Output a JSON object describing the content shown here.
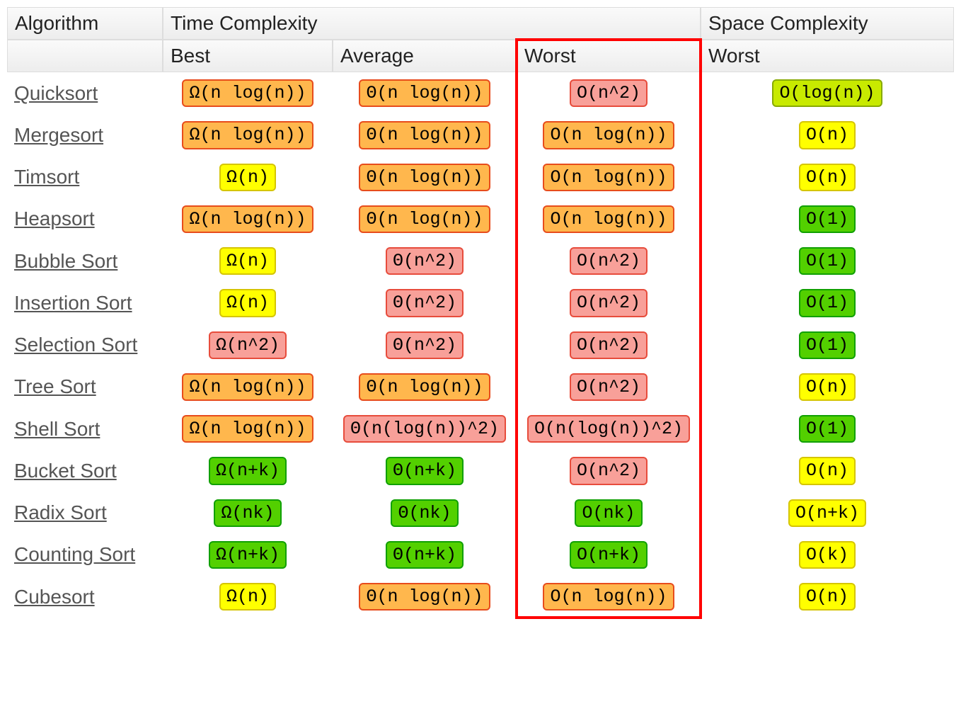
{
  "header": {
    "algorithm": "Algorithm",
    "time": "Time Complexity",
    "space": "Space Complexity",
    "best": "Best",
    "average": "Average",
    "worst": "Worst"
  },
  "colors": {
    "green": "c-green",
    "yellowgreen": "c-yg",
    "yellow": "c-yellow",
    "orange": "c-orange",
    "red": "c-red"
  },
  "rows": [
    {
      "name": "Quicksort",
      "best": {
        "v": "Ω(n log(n))",
        "c": "orange"
      },
      "avg": {
        "v": "Θ(n log(n))",
        "c": "orange"
      },
      "worst": {
        "v": "O(n^2)",
        "c": "red"
      },
      "space": {
        "v": "O(log(n))",
        "c": "yellowgreen"
      }
    },
    {
      "name": "Mergesort",
      "best": {
        "v": "Ω(n log(n))",
        "c": "orange"
      },
      "avg": {
        "v": "Θ(n log(n))",
        "c": "orange"
      },
      "worst": {
        "v": "O(n log(n))",
        "c": "orange"
      },
      "space": {
        "v": "O(n)",
        "c": "yellow"
      }
    },
    {
      "name": "Timsort",
      "best": {
        "v": "Ω(n)",
        "c": "yellow"
      },
      "avg": {
        "v": "Θ(n log(n))",
        "c": "orange"
      },
      "worst": {
        "v": "O(n log(n))",
        "c": "orange"
      },
      "space": {
        "v": "O(n)",
        "c": "yellow"
      }
    },
    {
      "name": "Heapsort",
      "best": {
        "v": "Ω(n log(n))",
        "c": "orange"
      },
      "avg": {
        "v": "Θ(n log(n))",
        "c": "orange"
      },
      "worst": {
        "v": "O(n log(n))",
        "c": "orange"
      },
      "space": {
        "v": "O(1)",
        "c": "green"
      }
    },
    {
      "name": "Bubble Sort",
      "best": {
        "v": "Ω(n)",
        "c": "yellow"
      },
      "avg": {
        "v": "Θ(n^2)",
        "c": "red"
      },
      "worst": {
        "v": "O(n^2)",
        "c": "red"
      },
      "space": {
        "v": "O(1)",
        "c": "green"
      }
    },
    {
      "name": "Insertion Sort",
      "best": {
        "v": "Ω(n)",
        "c": "yellow"
      },
      "avg": {
        "v": "Θ(n^2)",
        "c": "red"
      },
      "worst": {
        "v": "O(n^2)",
        "c": "red"
      },
      "space": {
        "v": "O(1)",
        "c": "green"
      }
    },
    {
      "name": "Selection Sort",
      "best": {
        "v": "Ω(n^2)",
        "c": "red"
      },
      "avg": {
        "v": "Θ(n^2)",
        "c": "red"
      },
      "worst": {
        "v": "O(n^2)",
        "c": "red"
      },
      "space": {
        "v": "O(1)",
        "c": "green"
      }
    },
    {
      "name": "Tree Sort",
      "best": {
        "v": "Ω(n log(n))",
        "c": "orange"
      },
      "avg": {
        "v": "Θ(n log(n))",
        "c": "orange"
      },
      "worst": {
        "v": "O(n^2)",
        "c": "red"
      },
      "space": {
        "v": "O(n)",
        "c": "yellow"
      }
    },
    {
      "name": "Shell Sort",
      "best": {
        "v": "Ω(n log(n))",
        "c": "orange"
      },
      "avg": {
        "v": "Θ(n(log(n))^2)",
        "c": "red"
      },
      "worst": {
        "v": "O(n(log(n))^2)",
        "c": "red"
      },
      "space": {
        "v": "O(1)",
        "c": "green"
      }
    },
    {
      "name": "Bucket Sort",
      "best": {
        "v": "Ω(n+k)",
        "c": "green"
      },
      "avg": {
        "v": "Θ(n+k)",
        "c": "green"
      },
      "worst": {
        "v": "O(n^2)",
        "c": "red"
      },
      "space": {
        "v": "O(n)",
        "c": "yellow"
      }
    },
    {
      "name": "Radix Sort",
      "best": {
        "v": "Ω(nk)",
        "c": "green"
      },
      "avg": {
        "v": "Θ(nk)",
        "c": "green"
      },
      "worst": {
        "v": "O(nk)",
        "c": "green"
      },
      "space": {
        "v": "O(n+k)",
        "c": "yellow"
      }
    },
    {
      "name": "Counting Sort",
      "best": {
        "v": "Ω(n+k)",
        "c": "green"
      },
      "avg": {
        "v": "Θ(n+k)",
        "c": "green"
      },
      "worst": {
        "v": "O(n+k)",
        "c": "green"
      },
      "space": {
        "v": "O(k)",
        "c": "yellow"
      }
    },
    {
      "name": "Cubesort",
      "best": {
        "v": "Ω(n)",
        "c": "yellow"
      },
      "avg": {
        "v": "Θ(n log(n))",
        "c": "orange"
      },
      "worst": {
        "v": "O(n log(n))",
        "c": "orange"
      },
      "space": {
        "v": "O(n)",
        "c": "yellow"
      }
    }
  ],
  "highlight_column": "worst"
}
